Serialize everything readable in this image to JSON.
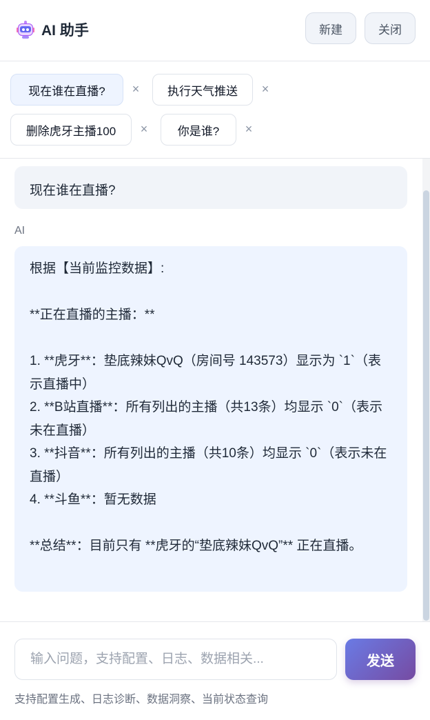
{
  "header": {
    "title": "AI 助手",
    "new_label": "新建",
    "close_label": "关闭"
  },
  "chips": [
    {
      "label": "现在谁在直播?",
      "active": true
    },
    {
      "label": "执行天气推送",
      "active": false
    },
    {
      "label": "删除虎牙主播100",
      "active": false
    },
    {
      "label": "你是谁?",
      "active": false
    }
  ],
  "chip_remove_glyph": "×",
  "conversation": {
    "user_message": "现在谁在直播?",
    "ai_label": "AI",
    "ai_message": "根据【当前监控数据】:\n\n**正在直播的主播：**\n\n1. **虎牙**：垫底辣妹QvQ（房间号 143573）显示为 `1`（表示直播中）\n2. **B站直播**：所有列出的主播（共13条）均显示 `0`（表示未在直播）\n3. **抖音**：所有列出的主播（共10条）均显示 `0`（表示未在直播）\n4. **斗鱼**：暂无数据\n\n**总结**：目前只有 **虎牙的“垫底辣妹QvQ”** 正在直播。"
  },
  "composer": {
    "placeholder": "输入问题，支持配置、日志、数据相关...",
    "send_label": "发送",
    "hint": "支持配置生成、日志诊断、数据洞察、当前状态查询"
  },
  "colors": {
    "accent_gradient_start": "#6a7be5",
    "accent_gradient_end": "#764ba2",
    "ai_bubble_bg": "#eef4ff",
    "user_bubble_bg": "#f1f4f9"
  },
  "icons": {
    "brand": "robot-icon",
    "chip_remove": "close-icon"
  }
}
